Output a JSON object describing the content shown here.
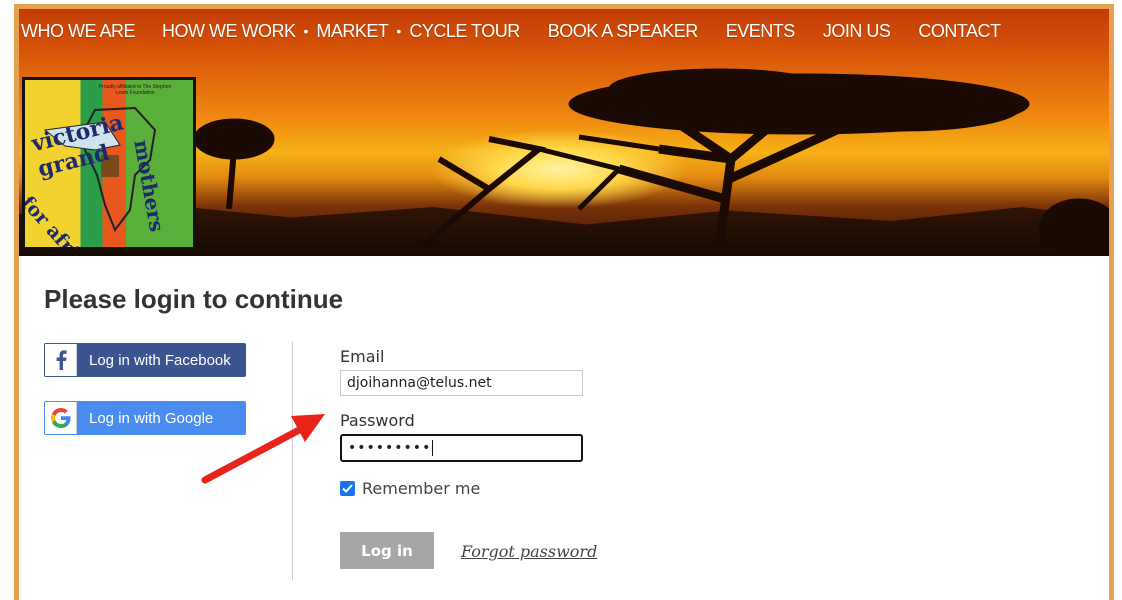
{
  "nav": {
    "items": [
      "WHO WE ARE",
      "HOW WE WORK",
      "MARKET",
      "CYCLE TOUR",
      "BOOK A SPEAKER",
      "EVENTS",
      "JOIN US",
      "CONTACT"
    ],
    "separator": "•"
  },
  "logo": {
    "line1": "victoria grand",
    "line2": "mothers",
    "line3": "for africa",
    "small_text": "Proudly affiliated to The Stephen Lewis Foundation"
  },
  "login": {
    "title": "Please login to continue",
    "facebook_label": "Log in with Facebook",
    "google_label": "Log in with Google",
    "email_label": "Email",
    "email_value": "djoihanna@telus.net",
    "password_label": "Password",
    "password_mask": "•••••••••",
    "remember_label": "Remember me",
    "remember_checked": true,
    "login_button": "Log in",
    "forgot_link": "Forgot password"
  },
  "colors": {
    "frame": "#e6a052",
    "facebook": "#3b5590",
    "google": "#4b8cf1",
    "login_button": "#a6a6a6",
    "arrow": "#e8231a"
  },
  "icons": {
    "facebook": "facebook-f-icon",
    "google": "google-g-icon",
    "checkbox": "checkmark-icon",
    "annotation": "red-arrow-icon"
  }
}
